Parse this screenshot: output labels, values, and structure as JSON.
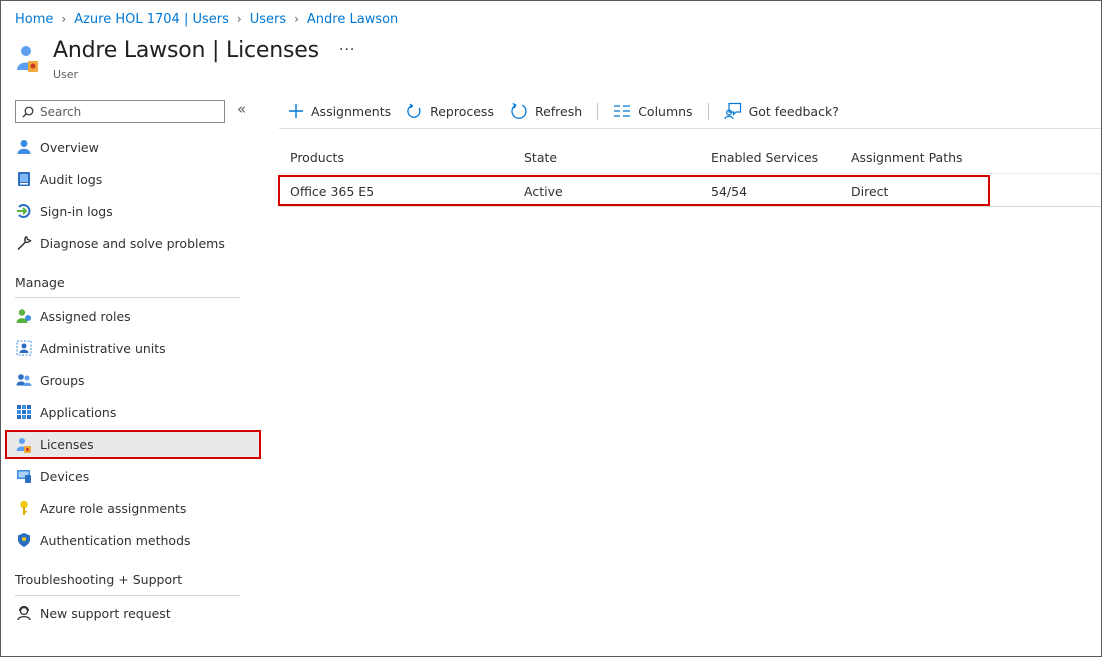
{
  "breadcrumb": [
    "Home",
    "Azure HOL 1704 | Users",
    "Users",
    "Andre Lawson"
  ],
  "header": {
    "title": "Andre Lawson | Licenses",
    "subtitle": "User",
    "more": "···"
  },
  "search": {
    "placeholder": "Search"
  },
  "collapse": "«",
  "sidebar": {
    "top_items": [
      {
        "label": "Overview",
        "icon": "user-icon"
      },
      {
        "label": "Audit logs",
        "icon": "audit-log-icon"
      },
      {
        "label": "Sign-in logs",
        "icon": "sign-in-icon"
      },
      {
        "label": "Diagnose and solve problems",
        "icon": "wrench-icon"
      }
    ],
    "manage_label": "Manage",
    "manage_items": [
      {
        "label": "Assigned roles",
        "icon": "assigned-roles-icon"
      },
      {
        "label": "Administrative units",
        "icon": "admin-units-icon"
      },
      {
        "label": "Groups",
        "icon": "groups-icon"
      },
      {
        "label": "Applications",
        "icon": "applications-grid-icon"
      },
      {
        "label": "Licenses",
        "icon": "licenses-icon",
        "selected": true
      },
      {
        "label": "Devices",
        "icon": "devices-icon"
      },
      {
        "label": "Azure role assignments",
        "icon": "key-icon"
      },
      {
        "label": "Authentication methods",
        "icon": "shield-icon"
      }
    ],
    "support_label": "Troubleshooting + Support",
    "support_items": [
      {
        "label": "New support request",
        "icon": "support-person-icon"
      }
    ]
  },
  "toolbar": {
    "assignments": "Assignments",
    "reprocess": "Reprocess",
    "refresh": "Refresh",
    "columns": "Columns",
    "feedback": "Got feedback?"
  },
  "table": {
    "columns": [
      "Products",
      "State",
      "Enabled Services",
      "Assignment Paths"
    ],
    "rows": [
      {
        "product": "Office 365 E5",
        "state": "Active",
        "enabled_services": "54/54",
        "assignment_path": "Direct"
      }
    ]
  },
  "colors": {
    "link": "#0078d4",
    "highlight": "#d40000",
    "selected_bg": "#e9e9e9"
  }
}
